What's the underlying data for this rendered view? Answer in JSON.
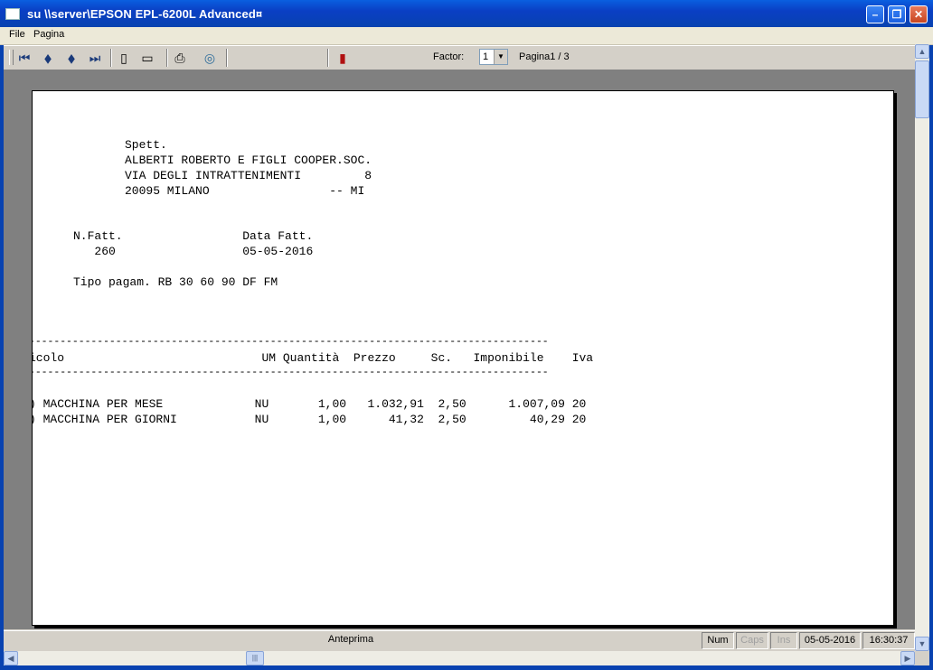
{
  "window": {
    "title": "su \\\\server\\EPSON EPL-6200L Advanced¤",
    "minimize_glyph": "–",
    "maximize_glyph": "❐",
    "close_glyph": "✕"
  },
  "menu": {
    "items": [
      "File",
      "Pagina"
    ]
  },
  "toolbar": {
    "factor_label": "Factor:",
    "factor_value": "1",
    "page_label": "Pagina1 / 3",
    "icons": {
      "first": "⏮",
      "prev": "◆",
      "next": "◆",
      "last": "⏭",
      "single_page": "▯",
      "two_pages": "▭",
      "print": "⎙",
      "export": "◎",
      "exit": "▮"
    }
  },
  "document": {
    "address": [
      "Spett.",
      "ALBERTI ROBERTO E FIGLI COOPER.SOC.",
      "VIA DEGLI INTRATTENIMENTI         8",
      "20095 MILANO                 -- MI"
    ],
    "invoice_header": "N.Fatt.                 Data Fatt.",
    "invoice_values": "   260                  05-05-2016",
    "payment": "Tipo pagam. RB 30 60 90 DF FM",
    "separator": "------------------------------------------------------------------------------------",
    "columns": "icolo                            UM Quantità  Prezzo     Sc.   Imponibile    Iva",
    "rows": [
      ") MACCHINA PER MESE             NU       1,00   1.032,91  2,50      1.007,09 20",
      ") MACCHINA PER GIORNI           NU       1,00      41,32  2,50         40,29 20"
    ]
  },
  "status": {
    "main": "Anteprima",
    "num": "Num",
    "caps": "Caps",
    "ins": "Ins",
    "date": "05-05-2016",
    "time": "16:30:37"
  },
  "scrollbar": {
    "up": "▲",
    "down": "▼",
    "left": "◀",
    "right": "▶",
    "grip": "|||"
  },
  "colors": {
    "titlebar": "#0a4fd0",
    "workspace": "#808080",
    "paper": "#ffffff"
  }
}
